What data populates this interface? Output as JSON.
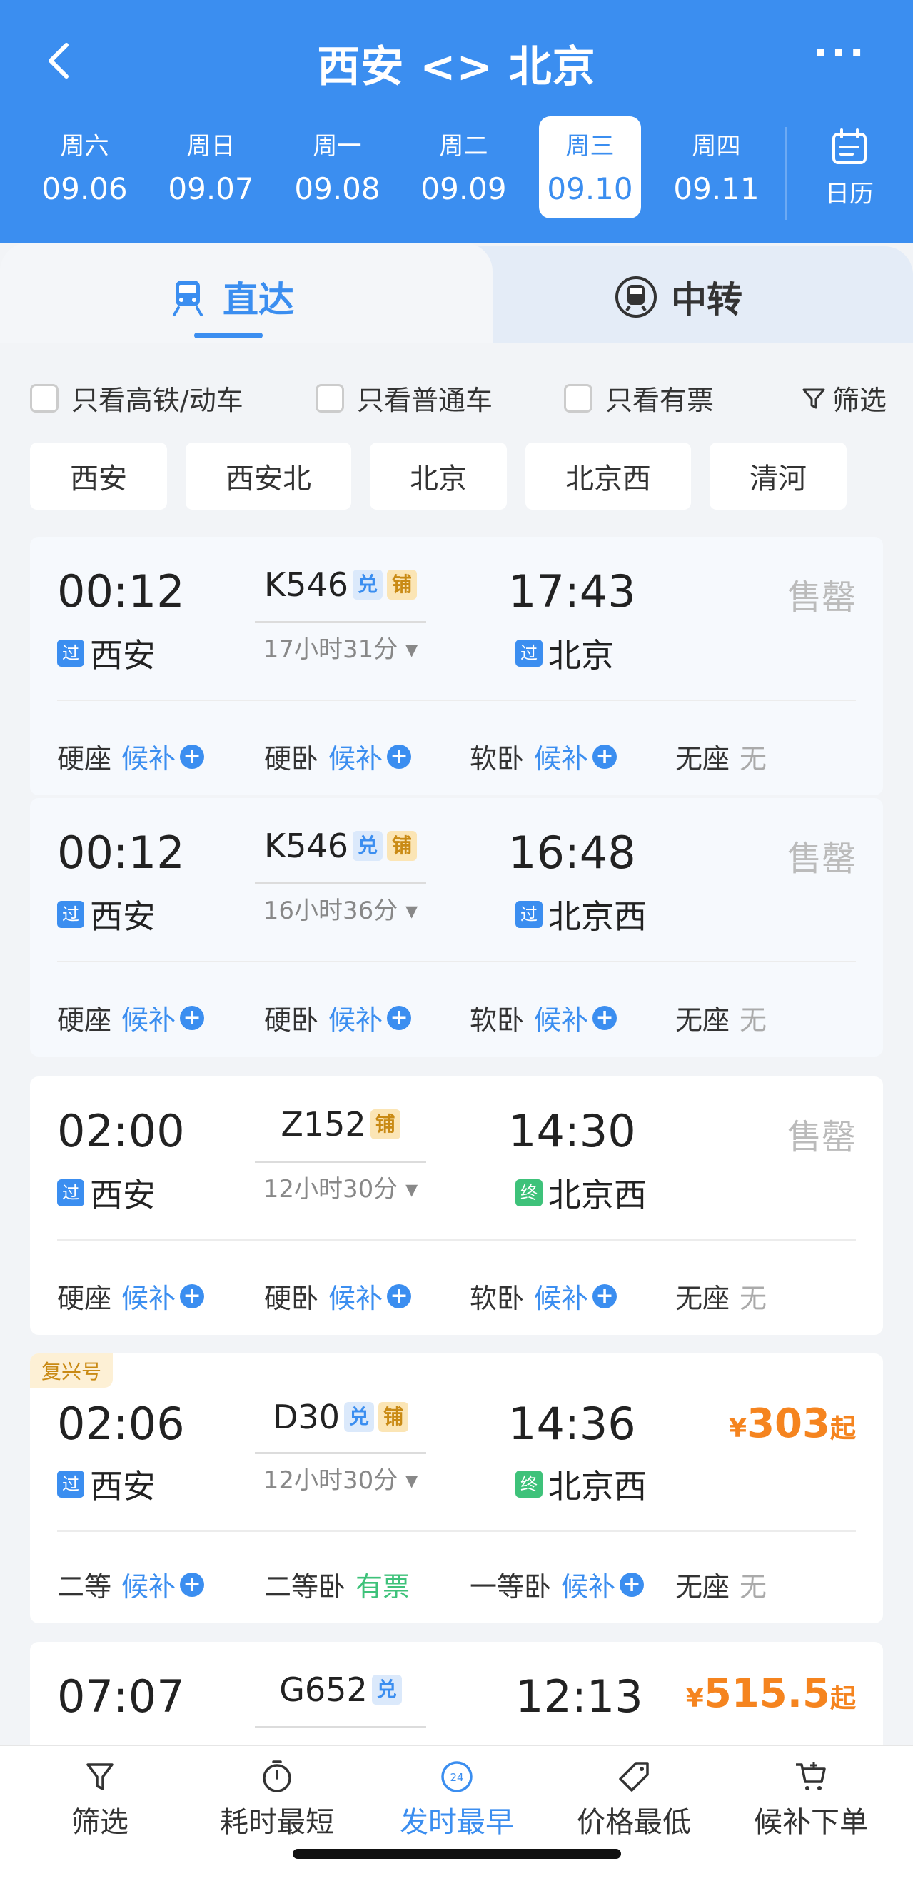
{
  "header": {
    "title": "西安 <> 北京",
    "more": "···",
    "dates": [
      {
        "week": "周六",
        "date": "09.06",
        "active": false
      },
      {
        "week": "周日",
        "date": "09.07",
        "active": false
      },
      {
        "week": "周一",
        "date": "09.08",
        "active": false
      },
      {
        "week": "周二",
        "date": "09.09",
        "active": false
      },
      {
        "week": "周三",
        "date": "09.10",
        "active": true
      },
      {
        "week": "周四",
        "date": "09.11",
        "active": false
      }
    ],
    "calendar_label": "日历"
  },
  "tabs": {
    "direct": "直达",
    "transfer": "中转"
  },
  "filters": {
    "high_speed": "只看高铁/动车",
    "normal": "只看普通车",
    "available": "只看有票",
    "filter": "筛选"
  },
  "stations": [
    "西安",
    "西安北",
    "北京",
    "北京西",
    "清河"
  ],
  "trains": [
    {
      "dep_time": "00:12",
      "dep_badge": "过",
      "dep_station": "西安",
      "train_no": "K546",
      "tags": [
        "兑",
        "铺"
      ],
      "duration": "17小时31分",
      "arr_time": "17:43",
      "arr_badge": "过",
      "arr_station": "北京",
      "status": "售罄",
      "seats": [
        {
          "name": "硬座",
          "value": "候补"
        },
        {
          "name": "硬卧",
          "value": "候补"
        },
        {
          "name": "软卧",
          "value": "候补"
        },
        {
          "name": "无座",
          "value": "无"
        }
      ]
    },
    {
      "dep_time": "00:12",
      "dep_badge": "过",
      "dep_station": "西安",
      "train_no": "K546",
      "tags": [
        "兑",
        "铺"
      ],
      "duration": "16小时36分",
      "arr_time": "16:48",
      "arr_badge": "过",
      "arr_station": "北京西",
      "status": "售罄",
      "seats": [
        {
          "name": "硬座",
          "value": "候补"
        },
        {
          "name": "硬卧",
          "value": "候补"
        },
        {
          "name": "软卧",
          "value": "候补"
        },
        {
          "name": "无座",
          "value": "无"
        }
      ]
    },
    {
      "dep_time": "02:00",
      "dep_badge": "过",
      "dep_station": "西安",
      "train_no": "Z152",
      "tags": [
        "铺"
      ],
      "duration": "12小时30分",
      "arr_time": "14:30",
      "arr_badge": "终",
      "arr_station": "北京西",
      "status": "售罄",
      "seats": [
        {
          "name": "硬座",
          "value": "候补"
        },
        {
          "name": "硬卧",
          "value": "候补"
        },
        {
          "name": "软卧",
          "value": "候补"
        },
        {
          "name": "无座",
          "value": "无"
        }
      ]
    },
    {
      "label": "复兴号",
      "dep_time": "02:06",
      "dep_badge": "过",
      "dep_station": "西安",
      "train_no": "D30",
      "tags": [
        "兑",
        "铺"
      ],
      "duration": "12小时30分",
      "arr_time": "14:36",
      "arr_badge": "终",
      "arr_station": "北京西",
      "price_symbol": "¥",
      "price": "303",
      "price_suffix": "起",
      "seats": [
        {
          "name": "二等",
          "value": "候补"
        },
        {
          "name": "二等卧",
          "value": "有票"
        },
        {
          "name": "一等卧",
          "value": "候补"
        },
        {
          "name": "无座",
          "value": "无"
        }
      ]
    },
    {
      "dep_time": "07:07",
      "train_no": "G652",
      "tags": [
        "兑"
      ],
      "arr_time": "12:13",
      "price_symbol": "¥",
      "price": "515.5",
      "price_suffix": "起"
    }
  ],
  "bottom_bar": [
    {
      "label": "筛选",
      "icon": "filter-icon"
    },
    {
      "label": "耗时最短",
      "icon": "timer-icon"
    },
    {
      "label": "发时最早",
      "icon": "clock-24-icon",
      "active": true
    },
    {
      "label": "价格最低",
      "icon": "price-tag-icon"
    },
    {
      "label": "候补下单",
      "icon": "cart-icon"
    }
  ],
  "colors": {
    "primary": "#3b8ef0",
    "price": "#f5841f",
    "available": "#3ec27a"
  }
}
